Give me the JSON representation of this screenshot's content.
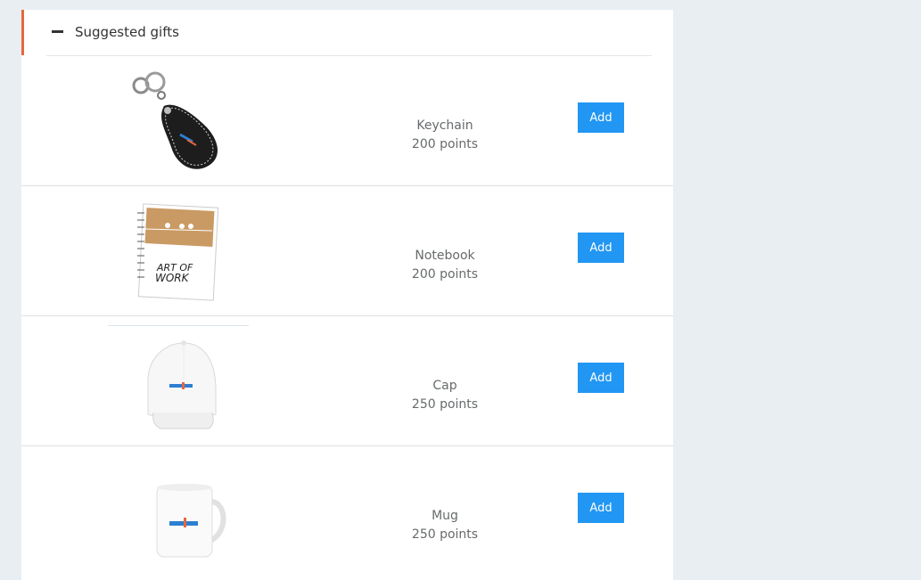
{
  "panel": {
    "title": "Suggested gifts",
    "collapse_icon": "minus-icon",
    "accent_color": "#e8673c"
  },
  "button_color": "#2196f3",
  "gifts": [
    {
      "name": "Keychain",
      "points": "200 points",
      "add_label": "Add",
      "image": "keychain-image"
    },
    {
      "name": "Notebook",
      "points": "200 points",
      "add_label": "Add",
      "image": "notebook-image",
      "cover_text_1": "ART OF",
      "cover_text_2": "WORK"
    },
    {
      "name": "Cap",
      "points": "250 points",
      "add_label": "Add",
      "image": "cap-image"
    },
    {
      "name": "Mug",
      "points": "250 points",
      "add_label": "Add",
      "image": "mug-image"
    }
  ]
}
